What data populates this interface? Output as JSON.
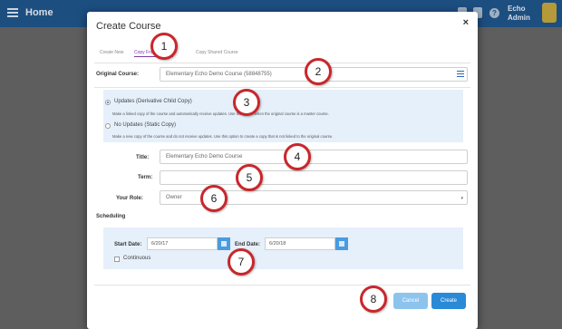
{
  "header": {
    "home_label": "Home",
    "user_first": "Echo",
    "user_last": "Admin",
    "help_glyph": "?"
  },
  "modal": {
    "title": "Create Course",
    "close_glyph": "×",
    "tabs": [
      {
        "label": "Create New"
      },
      {
        "label": "Copy From Domain"
      },
      {
        "label": "Copy Shared Course"
      }
    ],
    "original_course": {
      "label": "Original Course:",
      "value": "Elementary Echo Demo Course (58848755)"
    },
    "copy_options": [
      {
        "label": "Updates (Derivative Child Copy)",
        "description": "Make a linked copy of the course and automatically receive updates. Use this option when the original course is a master course.",
        "selected": true
      },
      {
        "label": "No Updates (Static Copy)",
        "description": "Make a new copy of the course and do not receive updates. Use this option to create a copy that is not linked to the original course.",
        "selected": false
      }
    ],
    "title_field": {
      "label": "Title:",
      "value": "Elementary Echo Demo Course"
    },
    "term_field": {
      "label": "Term:",
      "value": ""
    },
    "role_field": {
      "label": "Your Role:",
      "value": "Owner",
      "caret": "▾"
    },
    "scheduling": {
      "title": "Scheduling",
      "start_label": "Start Date:",
      "start_value": "6/20/17",
      "end_label": "End Date:",
      "end_value": "6/20/18",
      "continuous_label": "Continuous"
    },
    "cancel_label": "Cancel",
    "create_label": "Create"
  },
  "markers": [
    "1",
    "2",
    "3",
    "4",
    "5",
    "6",
    "7",
    "8"
  ],
  "colors": {
    "accent": "#2a8ad6",
    "marker_ring": "#c9262b",
    "panel": "#e6f0fb"
  }
}
